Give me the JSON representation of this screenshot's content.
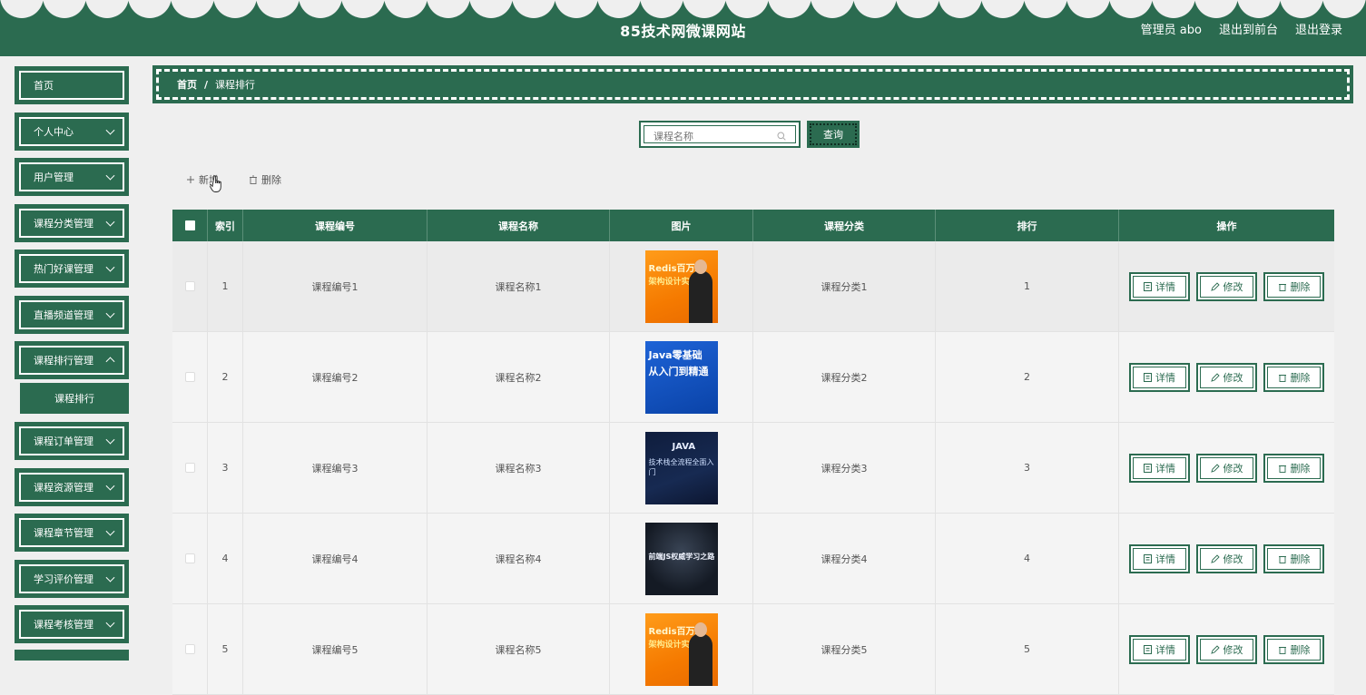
{
  "header": {
    "title": "85技术网微课网站",
    "admin": "管理员 abo",
    "link_front": "退出到前台",
    "link_logout": "退出登录"
  },
  "sidebar": {
    "items": [
      {
        "label": "首页",
        "expandable": false
      },
      {
        "label": "个人中心",
        "expandable": true
      },
      {
        "label": "用户管理",
        "expandable": true
      },
      {
        "label": "课程分类管理",
        "expandable": true
      },
      {
        "label": "热门好课管理",
        "expandable": true
      },
      {
        "label": "直播频道管理",
        "expandable": true
      },
      {
        "label": "课程排行管理",
        "expandable": true
      },
      {
        "label": "课程订单管理",
        "expandable": true
      },
      {
        "label": "课程资源管理",
        "expandable": true
      },
      {
        "label": "课程章节管理",
        "expandable": true
      },
      {
        "label": "学习评价管理",
        "expandable": true
      },
      {
        "label": "课程考核管理",
        "expandable": true
      }
    ],
    "active_sub": "课程排行"
  },
  "breadcrumb": {
    "home": "首页",
    "separator": "/",
    "current": "课程排行"
  },
  "search": {
    "placeholder": "课程名称",
    "button": "查询"
  },
  "actions": {
    "add": "新增",
    "delete": "删除"
  },
  "table": {
    "headers": [
      "索引",
      "课程编号",
      "课程名称",
      "图片",
      "课程分类",
      "排行",
      "操作"
    ],
    "rows": [
      {
        "index": "1",
        "code": "课程编号1",
        "name": "课程名称1",
        "category": "课程分类1",
        "rank": "1"
      },
      {
        "index": "2",
        "code": "课程编号2",
        "name": "课程名称2",
        "category": "课程分类2",
        "rank": "2"
      },
      {
        "index": "3",
        "code": "课程编号3",
        "name": "课程名称3",
        "category": "课程分类3",
        "rank": "3"
      },
      {
        "index": "4",
        "code": "课程编号4",
        "name": "课程名称4",
        "category": "课程分类4",
        "rank": "4"
      },
      {
        "index": "5",
        "code": "课程编号5",
        "name": "课程名称5",
        "category": "课程分类5",
        "rank": "5"
      }
    ],
    "ops": {
      "detail": "详情",
      "edit": "修改",
      "delete": "删除"
    }
  },
  "images": {
    "img1": {
      "line1": "Redis百万级",
      "line2": "架构设计实战"
    },
    "img2": {
      "line1": "Java零基础",
      "line2": "从入门到精通"
    },
    "img3": {
      "line1": "JAVA",
      "line2": "技术栈全流程全面入门"
    },
    "img4": {
      "line1": "前端JS权威学习之路"
    },
    "img5": {
      "line1": "Redis百万级",
      "line2": "架构设计实战"
    }
  },
  "colors": {
    "primary": "#2b6b50",
    "background": "#efefef"
  }
}
